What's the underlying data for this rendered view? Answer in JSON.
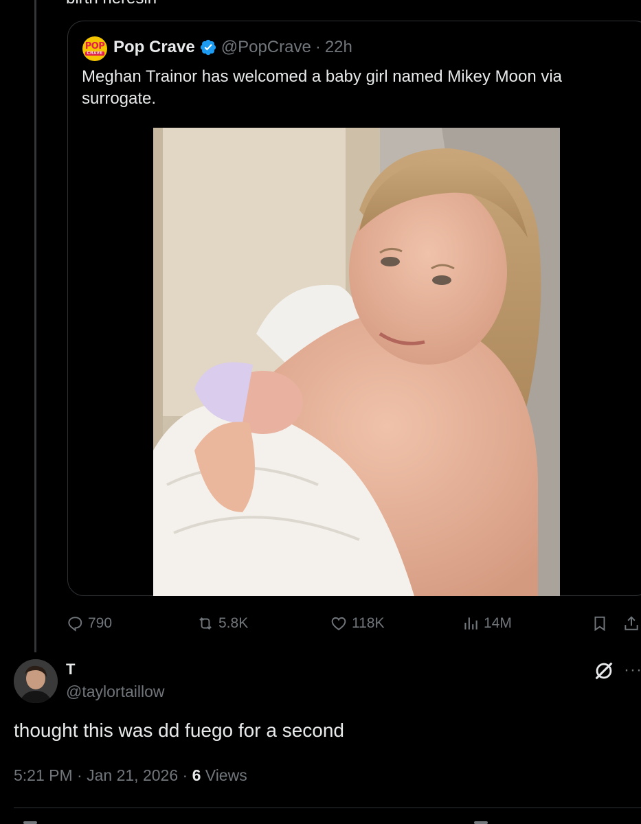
{
  "cutoff_text": "birth heresin",
  "quoted_tweet": {
    "author_name": "Pop Crave",
    "handle": "@PopCrave",
    "separator": "·",
    "time": "22h",
    "avatar_text_top": "POP",
    "avatar_text_bottom": "CRAVE",
    "text": "Meghan Trainor has welcomed a baby girl named Mikey Moon via surrogate.",
    "verified": true,
    "accent": "#1d9bf0"
  },
  "action_bar": {
    "replies": "790",
    "reposts": "5.8K",
    "likes": "118K",
    "views": "14M",
    "icons": [
      "reply-icon",
      "repost-icon",
      "like-icon",
      "views-icon",
      "bookmark-icon",
      "share-icon"
    ]
  },
  "reply_tweet": {
    "author_name": "T",
    "handle": "@taylortaillow",
    "text": "thought this was dd fuego for a second",
    "time": "5:21 PM",
    "separator": "·",
    "date": "Jan 21, 2026",
    "views_count": "6",
    "views_label": "Views"
  },
  "colors": {
    "background": "#000000",
    "text": "#e7e9ea",
    "muted": "#71767b",
    "border": "#2f3336"
  }
}
